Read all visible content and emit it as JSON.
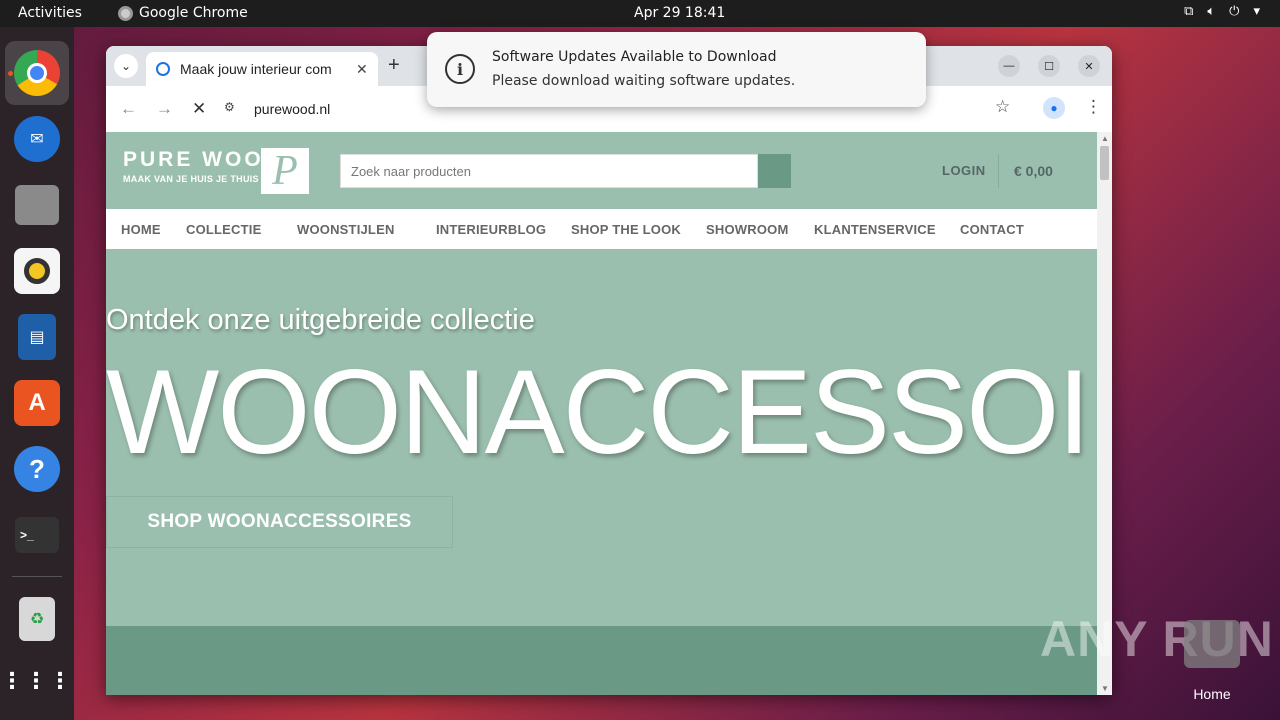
{
  "topbar": {
    "activities": "Activities",
    "app_name": "Google Chrome",
    "clock": "Apr 29  18:41",
    "tray_icons": [
      "network-icon",
      "volume-icon",
      "power-icon",
      "menu-icon"
    ]
  },
  "dock": {
    "items": [
      "chrome-icon",
      "thunderbird-icon",
      "files-icon",
      "rhythmbox-icon",
      "libreoffice-impress-icon",
      "app-center-icon",
      "help-icon",
      "terminal-icon",
      "trash-icon",
      "apps-grid-icon"
    ]
  },
  "browser": {
    "tab_title": "Maak jouw interieur com",
    "new_tab": "+",
    "url": "purewood.nl",
    "window_controls": [
      "minimize",
      "maximize",
      "close"
    ]
  },
  "site": {
    "brand": "PURE WOOD",
    "tagline": "MAAK VAN JE HUIS JE THUIS",
    "logo_letter": "P",
    "search_placeholder": "Zoek naar producten",
    "login": "LOGIN",
    "cart": "€ 0,00",
    "menu": [
      "HOME",
      "COLLECTIE",
      "WOONSTIJLEN",
      "INTERIEURBLOG",
      "SHOP THE LOOK",
      "SHOWROOM",
      "KLANTENSERVICE",
      "CONTACT"
    ],
    "hero_subtitle": "Ontdek onze uitgebreide collectie",
    "hero_title": "WOONACCESSOIRES",
    "hero_button": "SHOP WOONACCESSOIRES",
    "colors": {
      "sage": "#9bbfae",
      "dark_sage": "#6a9a86"
    }
  },
  "notification": {
    "title": "Software Updates Available to Download",
    "body": "Please download waiting software updates."
  },
  "desktop": {
    "home_label": "Home",
    "watermark": "ANY RUN"
  }
}
